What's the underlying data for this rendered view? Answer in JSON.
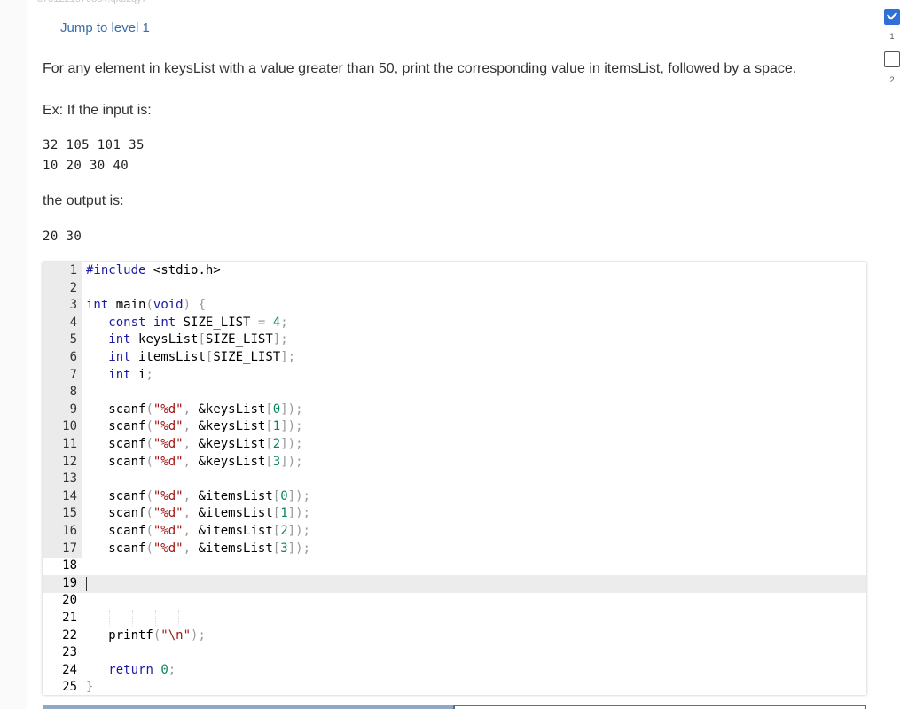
{
  "top_id": "3751221970834.qx3zqy7",
  "jump_link": "Jump to level 1",
  "prompt": "For any element in keysList with a value greater than 50, print the corresponding value in itemsList, followed by a space.",
  "example_label": "Ex: If the input is:",
  "input_lines": [
    "32 105 101 35",
    "10 20 30 40"
  ],
  "output_label": "the output is:",
  "output_line": "20 30",
  "levels": [
    {
      "number": "1",
      "state": "completed"
    },
    {
      "number": "2",
      "state": "open"
    }
  ],
  "code_lines": [
    "#include <stdio.h>",
    "",
    "int main(void) {",
    "   const int SIZE_LIST = 4;",
    "   int keysList[SIZE_LIST];",
    "   int itemsList[SIZE_LIST];",
    "   int i;",
    "",
    "   scanf(\"%d\", &keysList[0]);",
    "   scanf(\"%d\", &keysList[1]);",
    "   scanf(\"%d\", &keysList[2]);",
    "   scanf(\"%d\", &keysList[3]);",
    "",
    "   scanf(\"%d\", &itemsList[0]);",
    "   scanf(\"%d\", &itemsList[1]);",
    "   scanf(\"%d\", &itemsList[2]);",
    "   scanf(\"%d\", &itemsList[3]);",
    "",
    "",
    "",
    "",
    "   printf(\"\\n\");",
    "",
    "   return 0;",
    "}"
  ],
  "active_line": 19,
  "colors": {
    "link": "#3a6ea8",
    "check_fill": "#2f6fd6"
  }
}
